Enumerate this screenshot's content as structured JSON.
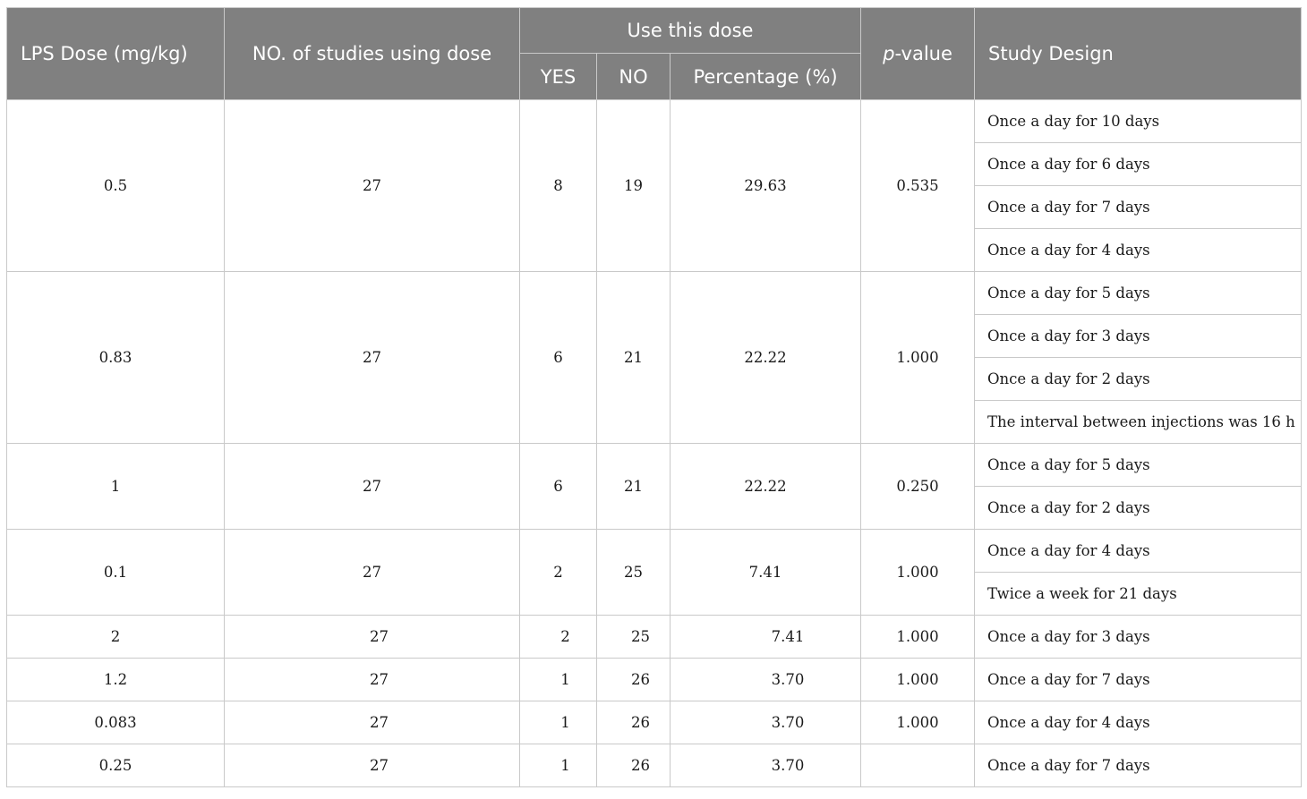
{
  "headers": {
    "dose": "LPS Dose (mg/kg)",
    "studies": "NO. of studies using dose",
    "use_group": "Use this dose",
    "yes": "YES",
    "no": "NO",
    "percentage": "Percentage (%)",
    "p_italic": "p",
    "p_rest": "-value",
    "design": "Study Design"
  },
  "rows": [
    {
      "dose": "0.5",
      "studies": "27",
      "yes": "8",
      "no": "19",
      "percentage": "29.63",
      "p": "0.535",
      "designs": [
        "Once a day for 10 days",
        "Once a day for 6 days",
        "Once a day for 7 days",
        "Once a day for 4 days"
      ]
    },
    {
      "dose": "0.83",
      "studies": "27",
      "yes": "6",
      "no": "21",
      "percentage": "22.22",
      "p": "1.000",
      "designs": [
        "Once a day for 5 days",
        "Once a day for 3 days",
        "Once a day for 2 days",
        "The interval between injections was 16 h"
      ]
    },
    {
      "dose": "1",
      "studies": "27",
      "yes": "6",
      "no": "21",
      "percentage": "22.22",
      "p": "0.250",
      "designs": [
        "Once a day for 5 days",
        "Once a day for 2 days"
      ]
    },
    {
      "dose": "0.1",
      "studies": "27",
      "yes": "2",
      "no": "25",
      "percentage": "7.41",
      "p": "1.000",
      "designs": [
        "Once a day for 4 days",
        "Twice a week for 21 days"
      ]
    },
    {
      "dose": "2",
      "studies": "27",
      "yes": "2",
      "no": "25",
      "percentage": "7.41",
      "p": "1.000",
      "designs": [
        "Once a day for 3 days"
      ]
    },
    {
      "dose": "1.2",
      "studies": "27",
      "yes": "1",
      "no": "26",
      "percentage": "3.70",
      "p": "1.000",
      "designs": [
        "Once a day for 7 days"
      ]
    },
    {
      "dose": "0.083",
      "studies": "27",
      "yes": "1",
      "no": "26",
      "percentage": "3.70",
      "p": "1.000",
      "designs": [
        "Once a day for 4 days"
      ]
    },
    {
      "dose": "0.25",
      "studies": "27",
      "yes": "1",
      "no": "26",
      "percentage": "3.70",
      "p": "",
      "designs": [
        "Once a day for 7 days"
      ]
    }
  ]
}
